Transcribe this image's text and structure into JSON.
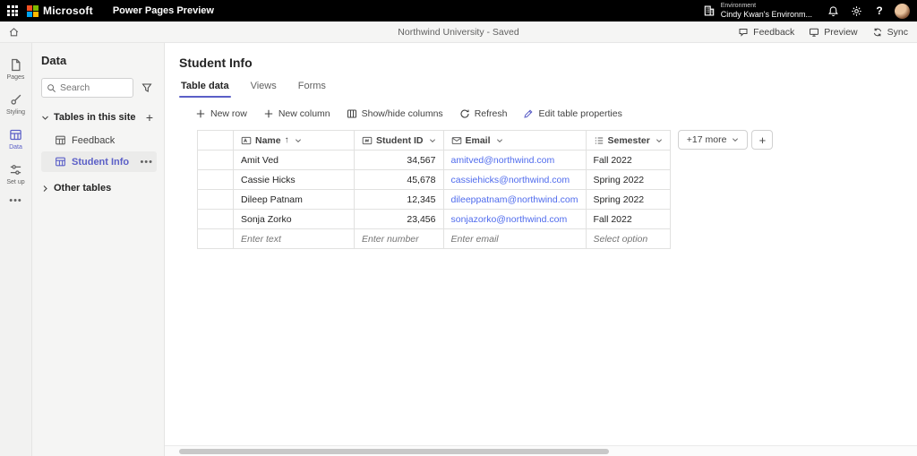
{
  "accent_color": "#5b5fc7",
  "link_color": "#4f6bed",
  "topbar": {
    "brand": "Microsoft",
    "app_name": "Power Pages Preview",
    "environment_label": "Environment",
    "environment_name": "Cindy Kwan's Environm..."
  },
  "command_bar": {
    "title": "Northwind University - Saved",
    "feedback_label": "Feedback",
    "preview_label": "Preview",
    "sync_label": "Sync"
  },
  "rail": {
    "items": [
      {
        "label": "Pages",
        "selected": false
      },
      {
        "label": "Styling",
        "selected": false
      },
      {
        "label": "Data",
        "selected": true
      },
      {
        "label": "Set up",
        "selected": false
      }
    ]
  },
  "sidebar": {
    "title": "Data",
    "search_placeholder": "Search",
    "tables_section_label": "Tables in this site",
    "tables": [
      {
        "label": "Feedback",
        "selected": false
      },
      {
        "label": "Student Info",
        "selected": true
      }
    ],
    "other_tables_label": "Other tables"
  },
  "main": {
    "title": "Student Info",
    "tabs": [
      {
        "label": "Table data",
        "selected": true
      },
      {
        "label": "Views",
        "selected": false
      },
      {
        "label": "Forms",
        "selected": false
      }
    ],
    "toolbar": {
      "new_row": "New row",
      "new_column": "New column",
      "show_hide_columns": "Show/hide columns",
      "refresh": "Refresh",
      "edit_table_properties": "Edit table properties"
    },
    "table": {
      "columns": [
        {
          "label": "Name",
          "sorted": "asc"
        },
        {
          "label": "Student ID"
        },
        {
          "label": "Email"
        },
        {
          "label": "Semester"
        }
      ],
      "more_columns_label": "+17 more",
      "rows": [
        {
          "name": "Amit Ved",
          "student_id": "34,567",
          "email": "amitved@northwind.com",
          "semester": "Fall 2022"
        },
        {
          "name": "Cassie Hicks",
          "student_id": "45,678",
          "email": "cassiehicks@northwind.com",
          "semester": "Spring 2022"
        },
        {
          "name": "Dileep Patnam",
          "student_id": "12,345",
          "email": "dileeppatnam@northwind.com",
          "semester": "Spring 2022"
        },
        {
          "name": "Sonja Zorko",
          "student_id": "23,456",
          "email": "sonjazorko@northwind.com",
          "semester": "Fall 2022"
        }
      ],
      "new_row_placeholders": {
        "name": "Enter text",
        "student_id": "Enter number",
        "email": "Enter email",
        "semester": "Select option"
      }
    }
  }
}
